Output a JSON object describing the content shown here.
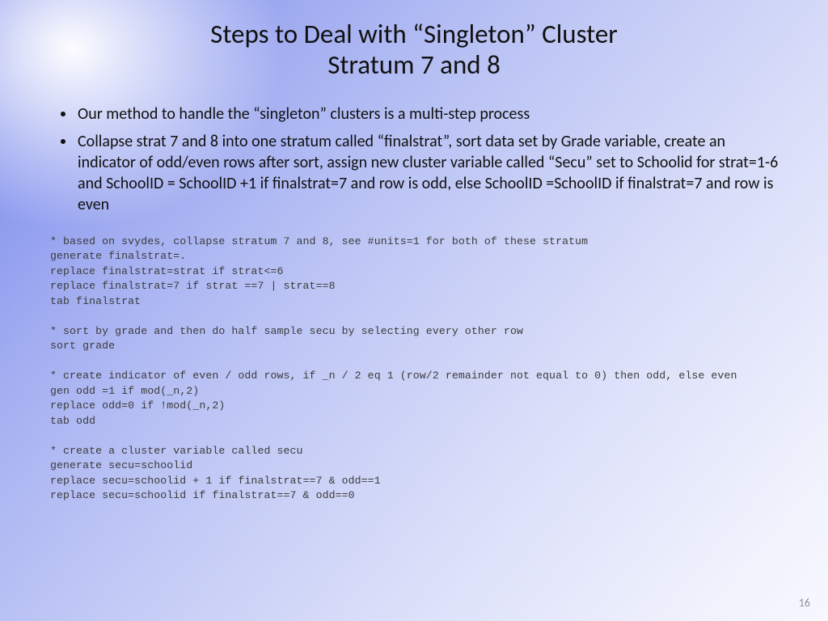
{
  "title": {
    "line1": "Steps to Deal with “Singleton” Cluster",
    "line2": "Stratum 7 and 8"
  },
  "bullets": [
    "Our method to handle the “singleton” clusters is a multi-step process",
    "Collapse strat 7 and 8 into one stratum called “finalstrat”, sort data set by Grade variable, create an indicator of odd/even rows after sort, assign new cluster variable called “Secu” set to Schoolid for strat=1-6 and SchoolID = SchoolID +1 if finalstrat=7 and row is odd, else SchoolID =SchoolID if finalstrat=7 and row is even"
  ],
  "code": "* based on svydes, collapse stratum 7 and 8, see #units=1 for both of these stratum\ngenerate finalstrat=.\nreplace finalstrat=strat if strat<=6\nreplace finalstrat=7 if strat ==7 | strat==8\ntab finalstrat\n\n* sort by grade and then do half sample secu by selecting every other row\nsort grade\n\n* create indicator of even / odd rows, if _n / 2 eq 1 (row/2 remainder not equal to 0) then odd, else even\ngen odd =1 if mod(_n,2)\nreplace odd=0 if !mod(_n,2)\ntab odd\n\n* create a cluster variable called secu\ngenerate secu=schoolid\nreplace secu=schoolid + 1 if finalstrat==7 & odd==1\nreplace secu=schoolid if finalstrat==7 & odd==0",
  "page_number": "16"
}
